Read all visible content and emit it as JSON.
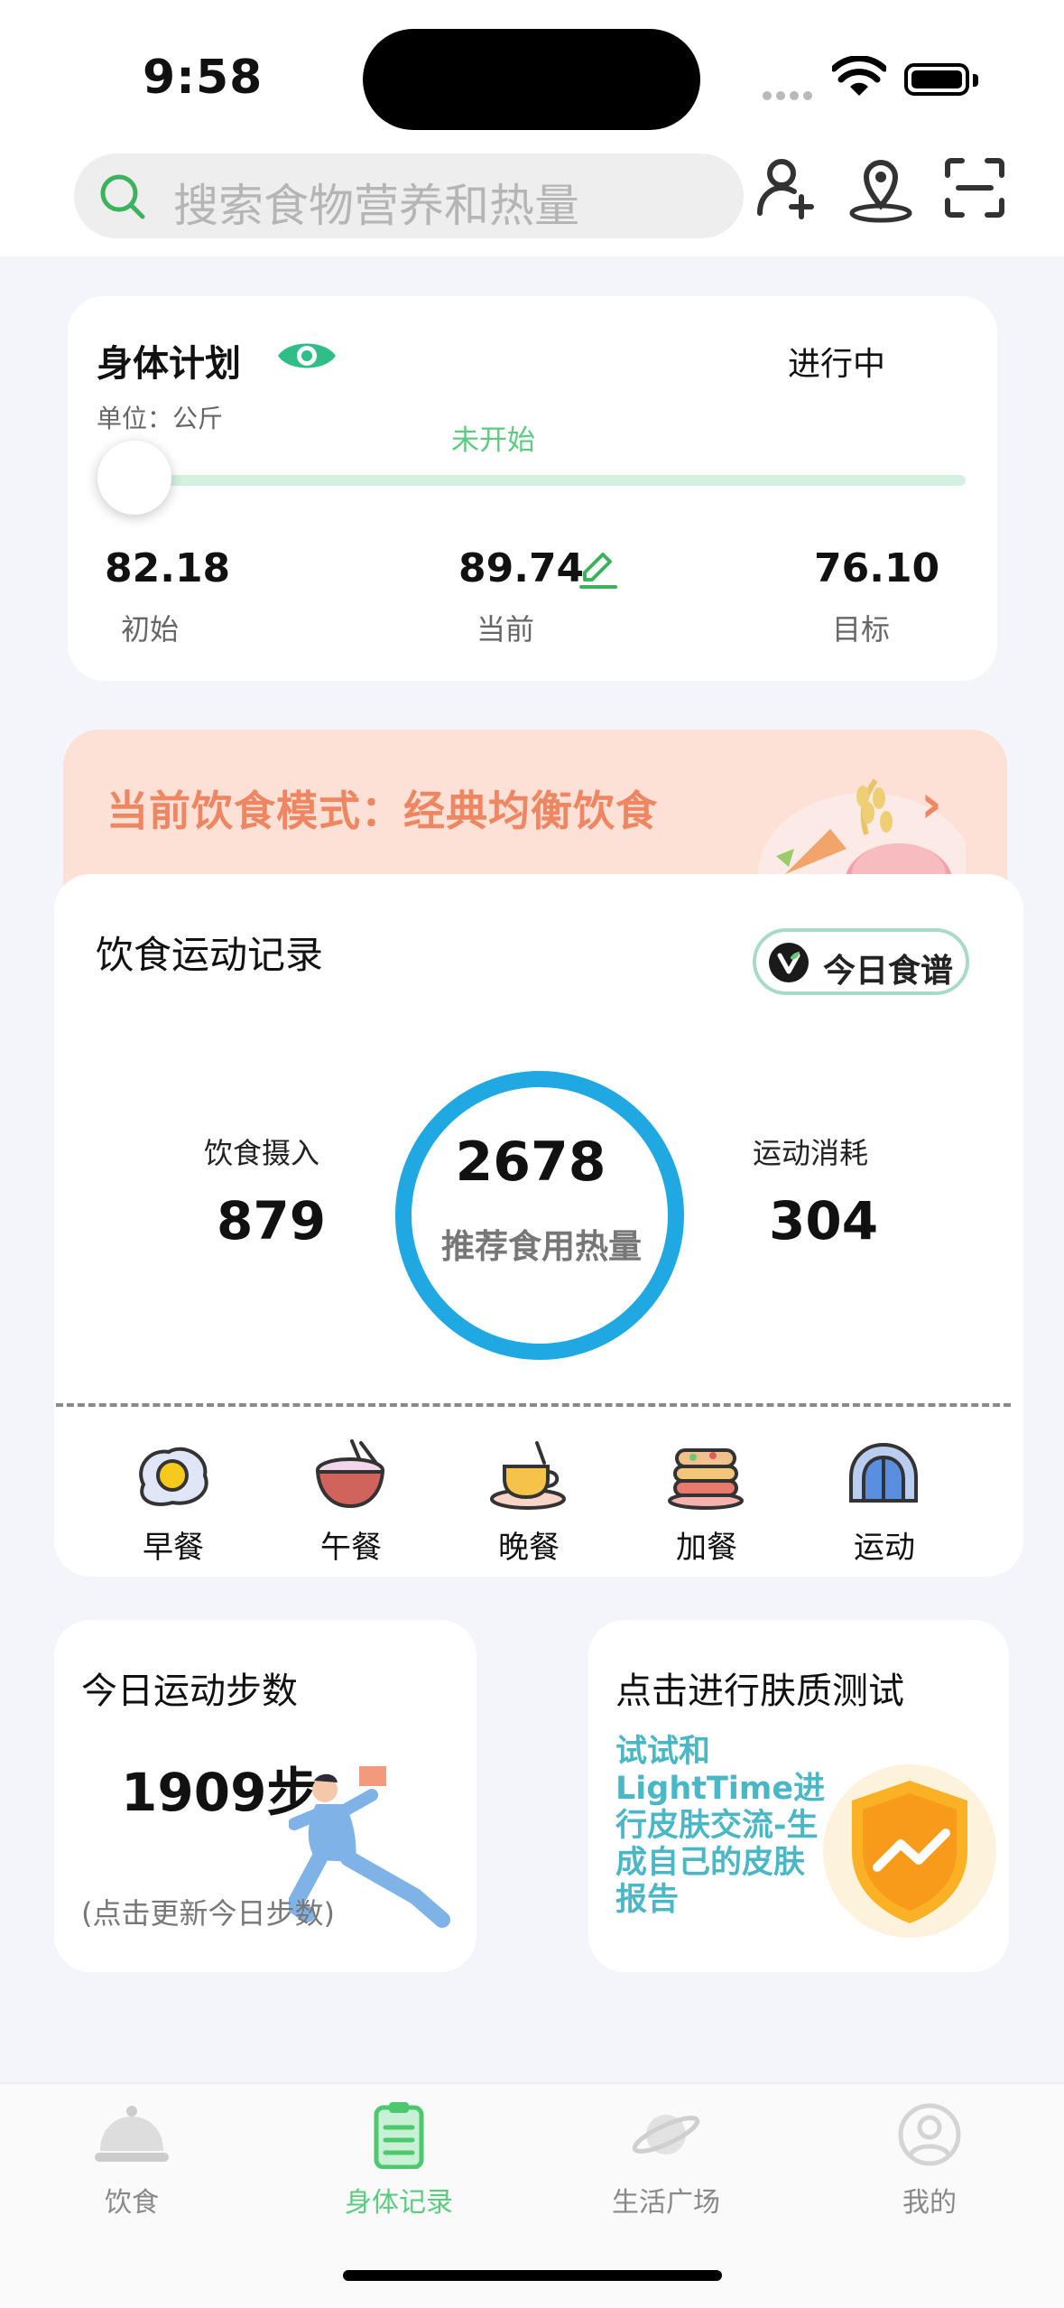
{
  "status_bar": {
    "time": "9:58"
  },
  "search": {
    "placeholder": "搜索食物营养和热量"
  },
  "header_icons": [
    "add-user-icon",
    "location-icon",
    "scan-icon"
  ],
  "body_plan": {
    "title": "身体计划",
    "status": "进行中",
    "unit": "单位：公斤",
    "progress_label": "未开始",
    "progress": 0,
    "initial": {
      "value": "82.18",
      "label": "初始"
    },
    "current": {
      "value": "89.74",
      "label": "当前"
    },
    "target": {
      "value": "76.10",
      "label": "目标"
    }
  },
  "diet_mode": {
    "text": "当前饮食模式：经典均衡饮食"
  },
  "record": {
    "title": "饮食运动记录",
    "recipe_button": "今日食谱",
    "intake": {
      "label": "饮食摄入",
      "value": "879"
    },
    "recommended": {
      "value": "2678",
      "label": "推荐食用热量"
    },
    "burn": {
      "label": "运动消耗",
      "value": "304"
    },
    "meals": [
      {
        "label": "早餐",
        "icon": "fried-egg-icon"
      },
      {
        "label": "午餐",
        "icon": "rice-bowl-icon"
      },
      {
        "label": "晚餐",
        "icon": "tea-cup-icon"
      },
      {
        "label": "加餐",
        "icon": "cake-icon"
      },
      {
        "label": "运动",
        "icon": "dome-icon"
      }
    ]
  },
  "steps": {
    "title": "今日运动步数",
    "value": "1909步",
    "hint": "(点击更新今日步数)"
  },
  "skin": {
    "title": "点击进行肤质测试",
    "desc": "试试和LightTime进行皮肤交流-生成自己的皮肤报告"
  },
  "tabbar": [
    {
      "label": "饮食",
      "icon": "food-cloche-icon",
      "active": false
    },
    {
      "label": "身体记录",
      "icon": "clipboard-icon",
      "active": true
    },
    {
      "label": "生活广场",
      "icon": "planet-icon",
      "active": false
    },
    {
      "label": "我的",
      "icon": "profile-icon",
      "active": false
    }
  ],
  "colors": {
    "accent_green": "#5bcc7f",
    "ring_blue": "#1fa8e2",
    "banner_bg": "#fde0d6",
    "banner_text": "#ef8662",
    "skin_text": "#4ab7c6"
  }
}
